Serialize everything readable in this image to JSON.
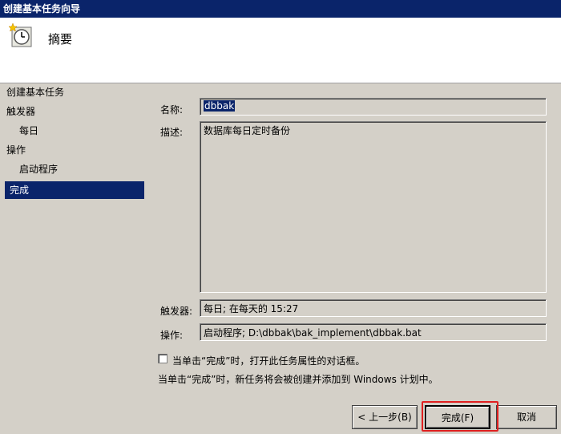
{
  "window": {
    "title": "创建基本任务向导"
  },
  "header": {
    "title": "摘要",
    "icon": "clock-task-icon"
  },
  "sidebar": {
    "items": [
      {
        "label": "创建基本任务"
      },
      {
        "label": "触发器"
      },
      {
        "label": "每日"
      },
      {
        "label": "操作"
      },
      {
        "label": "启动程序"
      },
      {
        "label": "完成"
      }
    ]
  },
  "form": {
    "name_label": "名称:",
    "name_value": "dbbak",
    "desc_label": "描述:",
    "desc_value": "数据库每日定时备份",
    "trigger_label": "触发器:",
    "trigger_value": "每日; 在每天的 15:27",
    "action_label": "操作:",
    "action_value": "启动程序; D:\\dbbak\\bak_implement\\dbbak.bat"
  },
  "options": {
    "open_props_label": "当单击“完成”时，打开此任务属性的对话框。",
    "open_props_checked": false,
    "info_text": "当单击“完成”时，新任务将会被创建并添加到 Windows 计划中。"
  },
  "buttons": {
    "back": "< 上一步(B)",
    "finish": "完成(F)",
    "cancel": "取消"
  }
}
